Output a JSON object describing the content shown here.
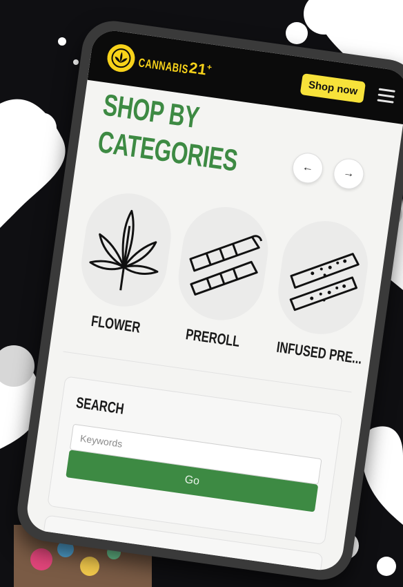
{
  "brand": {
    "logo_word": "CANNABIS",
    "logo_number": "21",
    "logo_plus": "+",
    "logo_color": "#f7d21a"
  },
  "header": {
    "shop_now_label": "Shop now",
    "menu_icon": "hamburger-menu-icon"
  },
  "section": {
    "title_line1": "SHOP BY",
    "title_line2": "CATEGORIES",
    "prev_icon": "arrow-left-icon",
    "next_icon": "arrow-right-icon",
    "prev_glyph": "←",
    "next_glyph": "→"
  },
  "categories": [
    {
      "label": "FLOWER",
      "icon": "cannabis-leaf-icon"
    },
    {
      "label": "PREROLL",
      "icon": "preroll-joints-icon"
    },
    {
      "label": "INFUSED PRE...",
      "icon": "infused-preroll-icon"
    }
  ],
  "search": {
    "title": "SEARCH",
    "placeholder": "Keywords",
    "value": "",
    "go_label": "Go"
  },
  "colors": {
    "accent_green": "#3d8a43",
    "brand_yellow": "#f7e23a",
    "header_black": "#0b0b0b"
  }
}
